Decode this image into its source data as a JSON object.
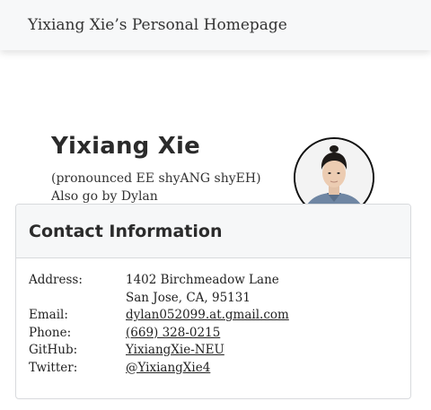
{
  "header": {
    "site_title": "Yixiang Xie’s Personal Homepage"
  },
  "profile": {
    "name": "Yixiang Xie",
    "pronunciation": "(pronounced EE shyANG shyEH)",
    "alias": "Also go by Dylan"
  },
  "contact": {
    "title": "Contact Information",
    "address_label": "Address:",
    "address_line1": "1402 Birchmeadow Lane",
    "address_line2": "San Jose, CA, 95131",
    "email_label": "Email:",
    "email": "dylan052099.at.gmail.com",
    "phone_label": "Phone:",
    "phone": "(669) 328-0215",
    "github_label": "GitHub:",
    "github": "YixiangXie-NEU",
    "twitter_label": "Twitter:",
    "twitter": "@YixiangXie4"
  },
  "colors": {
    "link": "#1a5fd6",
    "header_bg": "#f7f8f9"
  },
  "icons": {
    "avatar": "profile-photo"
  }
}
